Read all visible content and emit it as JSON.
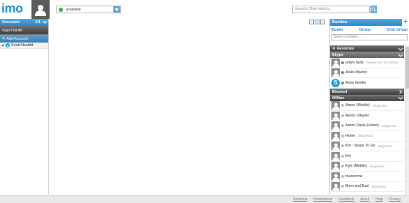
{
  "app": {
    "logo": "imo"
  },
  "status": {
    "value": "available",
    "color": "#3aa93a"
  },
  "search": {
    "placeholder": "Search Chat History..."
  },
  "accounts": {
    "title": "Accounts",
    "count": "1/1",
    "sign_out": "Sign Out All",
    "add_account": "Add Account",
    "items": [
      {
        "name": "Scott Nesbitt",
        "service": "skype",
        "checked": true
      }
    ]
  },
  "buddies": {
    "title": "Buddies",
    "tabs": [
      "Buddy",
      "Group",
      "Chat Group"
    ],
    "search_placeholder": "Search buddies...",
    "groups": {
      "favorites": "Favorites",
      "skype": "Skype",
      "blocked": "Blocked",
      "offline": "Offline"
    },
    "skype_buddies": [
      {
        "name": "adam hyde",
        "status": "Please text me before",
        "online": true
      },
      {
        "name": "Aleks Maricic",
        "status": "",
        "online": true
      },
      {
        "name": "Anne Gentle",
        "status": "",
        "online": true
      }
    ],
    "offline_buddies": [
      {
        "name": "Aaron (Mobile)",
        "status": "SkypeOut"
      },
      {
        "name": "Aaron (Skype)",
        "status": ""
      },
      {
        "name": "Aaron Davis (Home)",
        "status": "SkypeOut"
      },
      {
        "name": "Home",
        "status": "SkypeOut"
      },
      {
        "name": "Kiri - Skype To Go",
        "status": "SkypeOut"
      },
      {
        "name": "Kiri",
        "status": ""
      },
      {
        "name": "Kyle (Mobile)",
        "status": "SkypeOut"
      },
      {
        "name": "marksmnz",
        "status": ""
      },
      {
        "name": "Mom and Dad",
        "status": "SkypeOut"
      }
    ]
  },
  "footer": {
    "links": [
      "Sessions",
      "Preferences",
      "Feedback",
      "About",
      "Help",
      "Privacy"
    ]
  },
  "colors": {
    "accent": "#1c8fd6",
    "header_dark": "#4a4a4a",
    "online": "#3aa93a"
  }
}
